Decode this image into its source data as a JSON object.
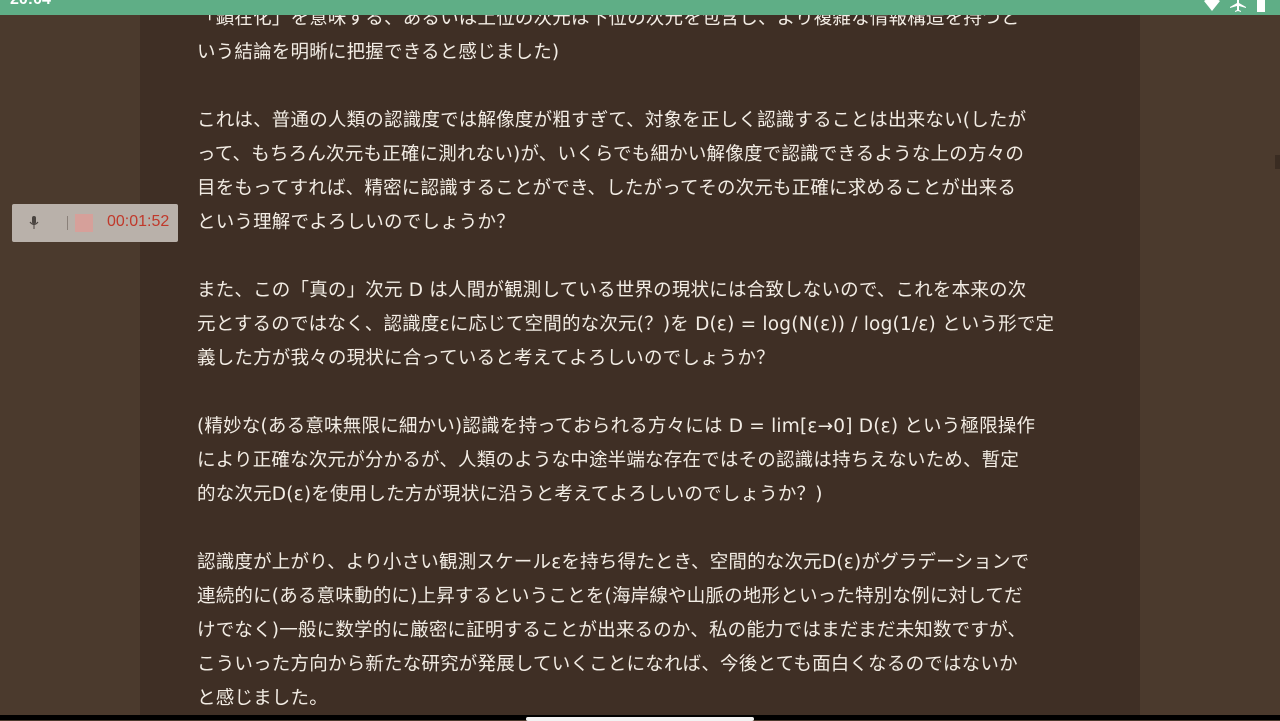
{
  "status_bar": {
    "time": "20:04",
    "color": "#5fae86",
    "icons": [
      "wifi-icon",
      "airplane-icon",
      "battery-icon"
    ]
  },
  "recorder": {
    "elapsed": "00:01:52",
    "icons": [
      "microphone-icon",
      "stop-icon"
    ]
  },
  "document": {
    "paragraphs": [
      {
        "lines": [
          "「顕在化」を意味する、あるいは上位の次元は下位の次元を包含し、より複雑な情報構造を持つと",
          "いう結論を明晰に把握できると感じました)"
        ]
      },
      {
        "lines": [
          "これは、普通の人類の認識度では解像度が粗すぎて、対象を正しく認識することは出来ない(したが",
          "って、もちろん次元も正確に測れない)が、いくらでも細かい解像度で認識できるような上の方々の",
          "目をもってすれば、精密に認識することができ、したがってその次元も正確に求めることが出来る",
          "という理解でよろしいのでしょうか？"
        ]
      },
      {
        "lines": [
          "また、この「真の」次元 D は人間が観測している世界の現状には合致しないので、これを本来の次",
          "元とするのではなく、認識度εに応じて空間的な次元(？)を D(ε) = log(N(ε)) / log(1/ε) という形で定",
          "義した方が我々の現状に合っていると考えてよろしいのでしょうか？"
        ]
      },
      {
        "lines": [
          "(精妙な(ある意味無限に細かい)認識を持っておられる方々には D = lim[ε→0] D(ε) という極限操作",
          "により正確な次元が分かるが、人類のような中途半端な存在ではその認識は持ちえないため、暫定",
          "的な次元D(ε)を使用した方が現状に沿うと考えてよろしいのでしょうか？)"
        ]
      },
      {
        "lines": [
          "認識度が上がり、より小さい観測スケールεを持ち得たとき、空間的な次元D(ε)がグラデーションで",
          "連続的に(ある意味動的に)上昇するということを(海岸線や山脈の地形といった特別な例に対してだ",
          "けでなく)一般に数学的に厳密に証明することが出来るのか、私の能力ではまだまだ未知数ですが、",
          "こういった方向から新たな研究が発展していくことになれば、今後とても面白くなるのではないか",
          "と感じました。"
        ]
      }
    ]
  }
}
